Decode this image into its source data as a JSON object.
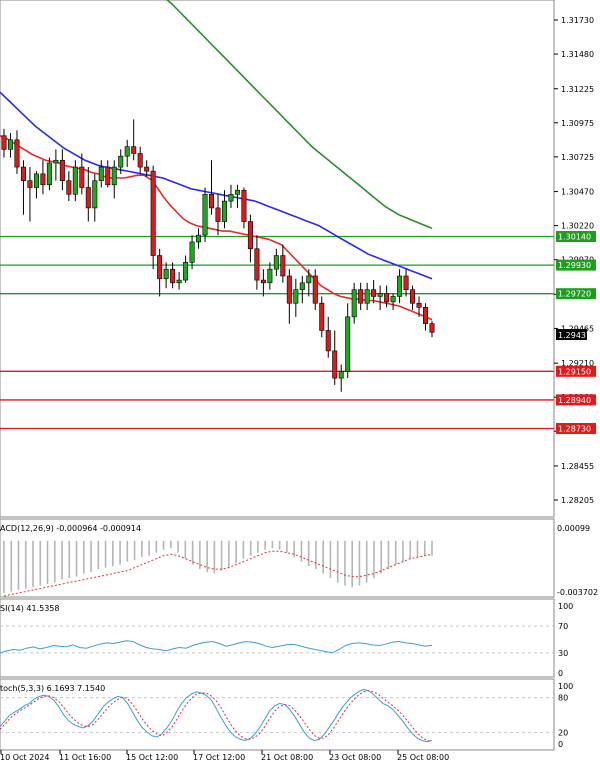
{
  "chart_data": {
    "type": "candlestick",
    "price_axis": {
      "ticks": [
        1.3173,
        1.3148,
        1.31225,
        1.30975,
        1.30725,
        1.3047,
        1.3022,
        1.2997,
        1.29715,
        1.29465,
        1.2921,
        1.2896,
        1.2871,
        1.28455,
        1.28205
      ],
      "tick_labels": [
        "1.31730",
        "1.31480",
        "1.31225",
        "1.30975",
        "1.30725",
        "1.30470",
        "1.30220",
        "1.29970",
        "1.29715",
        "1.29465",
        "1.29210",
        "1.28960",
        "1.28710",
        "1.28455",
        "1.28205"
      ],
      "range": [
        1.2802,
        1.3189
      ]
    },
    "x_labels": [
      "10 Oct 2024",
      "11 Oct 16:00",
      "15 Oct 12:00",
      "17 Oct 12:00",
      "21 Oct 08:00",
      "23 Oct 08:00",
      "25 Oct 08:00"
    ],
    "current_price": "1.29437",
    "resistance_levels": [
      {
        "value": 1.3014,
        "label": "1.30140",
        "color": "#1e9e1e"
      },
      {
        "value": 1.2993,
        "label": "1.29930",
        "color": "#1e9e1e"
      },
      {
        "value": 1.2972,
        "label": "1.29720",
        "color": "#1e9e1e"
      }
    ],
    "support_levels": [
      {
        "value": 1.2915,
        "label": "1.29150",
        "color": "#e31a1a"
      },
      {
        "value": 1.2894,
        "label": "1.28940",
        "color": "#e31a1a"
      },
      {
        "value": 1.2873,
        "label": "1.28730",
        "color": "#e31a1a"
      }
    ],
    "candles": [
      [
        1.3088,
        1.3093,
        1.3072,
        1.3078
      ],
      [
        1.3078,
        1.309,
        1.3072,
        1.3085
      ],
      [
        1.3085,
        1.3092,
        1.306,
        1.3065
      ],
      [
        1.3065,
        1.307,
        1.303,
        1.3055
      ],
      [
        1.3055,
        1.3065,
        1.3025,
        1.305
      ],
      [
        1.305,
        1.3062,
        1.3042,
        1.306
      ],
      [
        1.306,
        1.307,
        1.3045,
        1.3052
      ],
      [
        1.3052,
        1.3072,
        1.3048,
        1.3068
      ],
      [
        1.3068,
        1.3078,
        1.3055,
        1.307
      ],
      [
        1.307,
        1.3078,
        1.3048,
        1.3055
      ],
      [
        1.3055,
        1.3062,
        1.304,
        1.3045
      ],
      [
        1.3045,
        1.307,
        1.304,
        1.3065
      ],
      [
        1.3065,
        1.3075,
        1.3045,
        1.305
      ],
      [
        1.305,
        1.3065,
        1.3025,
        1.3035
      ],
      [
        1.3035,
        1.306,
        1.3025,
        1.3055
      ],
      [
        1.3055,
        1.307,
        1.305,
        1.3065
      ],
      [
        1.3065,
        1.307,
        1.305,
        1.3052
      ],
      [
        1.3052,
        1.307,
        1.3042,
        1.3065
      ],
      [
        1.3065,
        1.3078,
        1.306,
        1.3073
      ],
      [
        1.3073,
        1.3085,
        1.3065,
        1.308
      ],
      [
        1.308,
        1.31,
        1.307,
        1.3075
      ],
      [
        1.3075,
        1.308,
        1.306,
        1.3065
      ],
      [
        1.3065,
        1.307,
        1.3058,
        1.3062
      ],
      [
        1.3062,
        1.3066,
        1.299,
        1.3
      ],
      [
        1.3,
        1.3005,
        1.297,
        1.2983
      ],
      [
        1.2983,
        1.2995,
        1.2976,
        1.299
      ],
      [
        1.299,
        1.2995,
        1.2976,
        1.298
      ],
      [
        1.298,
        1.2988,
        1.2975,
        1.2982
      ],
      [
        1.2982,
        1.3,
        1.298,
        1.2995
      ],
      [
        1.2995,
        1.3015,
        1.299,
        1.301
      ],
      [
        1.301,
        1.302,
        1.3005,
        1.3015
      ],
      [
        1.3015,
        1.305,
        1.301,
        1.3045
      ],
      [
        1.3045,
        1.307,
        1.303,
        1.3035
      ],
      [
        1.3035,
        1.3045,
        1.3015,
        1.3025
      ],
      [
        1.3025,
        1.3048,
        1.302,
        1.304
      ],
      [
        1.304,
        1.3052,
        1.3035,
        1.3045
      ],
      [
        1.3045,
        1.3052,
        1.3035,
        1.3048
      ],
      [
        1.3048,
        1.305,
        1.302,
        1.3025
      ],
      [
        1.3025,
        1.303,
        1.2995,
        1.3005
      ],
      [
        1.3005,
        1.3015,
        1.2975,
        1.2982
      ],
      [
        1.2982,
        1.299,
        1.297,
        1.298
      ],
      [
        1.298,
        1.2995,
        1.2975,
        1.299
      ],
      [
        1.299,
        1.3005,
        1.2985,
        1.3
      ],
      [
        1.3,
        1.3008,
        1.298,
        1.2985
      ],
      [
        1.2985,
        1.299,
        1.295,
        1.2965
      ],
      [
        1.2965,
        1.2983,
        1.2955,
        1.2975
      ],
      [
        1.2975,
        1.2985,
        1.2965,
        1.298
      ],
      [
        1.298,
        1.299,
        1.297,
        1.2985
      ],
      [
        1.2985,
        1.299,
        1.296,
        1.2965
      ],
      [
        1.2965,
        1.297,
        1.294,
        1.2945
      ],
      [
        1.2945,
        1.2955,
        1.2925,
        1.293
      ],
      [
        1.293,
        1.2945,
        1.2905,
        1.291
      ],
      [
        1.291,
        1.292,
        1.29,
        1.2915
      ],
      [
        1.2915,
        1.2965,
        1.291,
        1.2955
      ],
      [
        1.2955,
        1.298,
        1.295,
        1.2975
      ],
      [
        1.2975,
        1.298,
        1.296,
        1.2965
      ],
      [
        1.2965,
        1.298,
        1.296,
        1.2975
      ],
      [
        1.2975,
        1.2982,
        1.2965,
        1.297
      ],
      [
        1.297,
        1.2978,
        1.296,
        1.2972
      ],
      [
        1.2972,
        1.2978,
        1.2962,
        1.2966
      ],
      [
        1.2966,
        1.2972,
        1.296,
        1.297
      ],
      [
        1.297,
        1.299,
        1.2965,
        1.2985
      ],
      [
        1.2985,
        1.299,
        1.297,
        1.2975
      ],
      [
        1.2975,
        1.2978,
        1.296,
        1.2965
      ],
      [
        1.2965,
        1.297,
        1.2955,
        1.2962
      ],
      [
        1.2962,
        1.2965,
        1.2945,
        1.295
      ],
      [
        1.295,
        1.2952,
        1.294,
        1.29437
      ]
    ],
    "series": [
      {
        "name": "",
        "color": "#e52a2a",
        "values": [
          1.3088,
          1.3086,
          1.3083,
          1.308,
          1.3077,
          1.3074,
          1.3072,
          1.307,
          1.3069,
          1.3068,
          1.3066,
          1.3065,
          1.3064,
          1.3063,
          1.3061,
          1.306,
          1.3058,
          1.3057,
          1.3057,
          1.3057,
          1.3058,
          1.3059,
          1.3059,
          1.3056,
          1.305,
          1.3043,
          1.3037,
          1.3032,
          1.3027,
          1.3024,
          1.3022,
          1.3021,
          1.302,
          1.3019,
          1.3018,
          1.3018,
          1.3017,
          1.3016,
          1.3015,
          1.3014,
          1.3013,
          1.3012,
          1.301,
          1.3008,
          1.3003,
          1.2998,
          1.2993,
          1.2988,
          1.2983,
          1.2978,
          1.2975,
          1.2972,
          1.297,
          1.2969,
          1.2968,
          1.2968,
          1.2967,
          1.2967,
          1.2966,
          1.2965,
          1.2964,
          1.2963,
          1.2961,
          1.2959,
          1.2957,
          1.2955,
          1.2953
        ]
      },
      {
        "name": "",
        "color": "#2a2aed",
        "values": [
          1.312,
          1.3115,
          1.311,
          1.3105,
          1.31,
          1.3095,
          1.3091,
          1.3087,
          1.3083,
          1.3079,
          1.3076,
          1.3073,
          1.307,
          1.3068,
          1.3066,
          1.3065,
          1.3064,
          1.3063,
          1.3062,
          1.3061,
          1.306,
          1.3059,
          1.3058,
          1.3057,
          1.3055,
          1.3053,
          1.3051,
          1.3049,
          1.3048,
          1.3047,
          1.3046,
          1.3045,
          1.3044,
          1.3043,
          1.3042,
          1.3041,
          1.304,
          1.3038,
          1.3036,
          1.3034,
          1.3032,
          1.303,
          1.3028,
          1.3026,
          1.3024,
          1.3022,
          1.3019,
          1.3016,
          1.3013,
          1.301,
          1.3007,
          1.3004,
          1.3001,
          1.2999,
          1.2997,
          1.2995,
          1.2993,
          1.2991,
          1.2989,
          1.2987,
          1.2985,
          1.2983
        ]
      },
      {
        "name": "",
        "color": "#2a8f2a",
        "values": [
          1.3189,
          1.3185,
          1.318,
          1.3175,
          1.317,
          1.3165,
          1.316,
          1.3155,
          1.315,
          1.3145,
          1.314,
          1.3135,
          1.313,
          1.3125,
          1.312,
          1.3115,
          1.311,
          1.3105,
          1.31,
          1.3095,
          1.309,
          1.3085,
          1.308,
          1.3076,
          1.3072,
          1.3068,
          1.3064,
          1.306,
          1.3056,
          1.3052,
          1.3048,
          1.3044,
          1.304,
          1.3036,
          1.3033,
          1.303,
          1.3028,
          1.3026,
          1.3024,
          1.3022,
          1.302
        ]
      }
    ],
    "macd": {
      "label": "ACD(12,26,9) -0.000964 -0.000914",
      "axis_top": "0.00099",
      "axis_bottom": "-0.003702",
      "histogram": [
        -0.0035,
        -0.0034,
        -0.0033,
        -0.0032,
        -0.0031,
        -0.003,
        -0.0029,
        -0.0028,
        -0.0026,
        -0.0025,
        -0.0024,
        -0.0022,
        -0.0021,
        -0.0019,
        -0.0018,
        -0.0017,
        -0.0016,
        -0.0014,
        -0.0013,
        -0.0011,
        -0.001,
        -0.0008,
        -0.0006,
        -0.0005,
        -0.0008,
        -0.0012,
        -0.0016,
        -0.0019,
        -0.0021,
        -0.0022,
        -0.002,
        -0.0018,
        -0.0015,
        -0.0012,
        -0.001,
        -0.0008,
        -0.0006,
        -0.0005,
        -0.0006,
        -0.0008,
        -0.0011,
        -0.0014,
        -0.0017,
        -0.0019,
        -0.0022,
        -0.0025,
        -0.0028,
        -0.003,
        -0.0031,
        -0.003,
        -0.0028,
        -0.0025,
        -0.0022,
        -0.0019,
        -0.0016,
        -0.0014,
        -0.0012,
        -0.0011,
        -0.001,
        -0.001
      ],
      "signal": [
        -0.0037,
        -0.0036,
        -0.0035,
        -0.0034,
        -0.0033,
        -0.0032,
        -0.0031,
        -0.003,
        -0.0029,
        -0.0028,
        -0.0027,
        -0.0026,
        -0.0025,
        -0.0024,
        -0.0023,
        -0.0022,
        -0.0021,
        -0.002,
        -0.0018,
        -0.0016,
        -0.0014,
        -0.0012,
        -0.001,
        -0.0009,
        -0.001,
        -0.0012,
        -0.0014,
        -0.0016,
        -0.0018,
        -0.0019,
        -0.0019,
        -0.0018,
        -0.0016,
        -0.0014,
        -0.0012,
        -0.001,
        -0.0008,
        -0.0007,
        -0.0007,
        -0.0008,
        -0.0009,
        -0.0011,
        -0.0013,
        -0.0015,
        -0.0017,
        -0.0019,
        -0.0021,
        -0.0023,
        -0.0024,
        -0.0024,
        -0.0023,
        -0.0022,
        -0.002,
        -0.0018,
        -0.0016,
        -0.0014,
        -0.0012,
        -0.0011,
        -0.001,
        -0.0009
      ]
    },
    "rsi": {
      "label": "SI(14) 41.5358",
      "levels": [
        100,
        70,
        30,
        0
      ],
      "values": [
        30,
        33,
        35,
        34,
        37,
        39,
        36,
        38,
        41,
        40,
        39,
        42,
        38,
        37,
        40,
        43,
        45,
        44,
        46,
        48,
        47,
        42,
        38,
        36,
        35,
        33,
        36,
        38,
        37,
        41,
        44,
        46,
        47,
        44,
        40,
        42,
        45,
        47,
        46,
        44,
        40,
        38,
        40,
        42,
        43,
        41,
        38,
        36,
        34,
        32,
        30,
        35,
        41,
        44,
        45,
        44,
        42,
        41,
        43,
        46,
        47,
        45,
        44,
        42,
        40,
        41.5
      ]
    },
    "stoch": {
      "label": "toch(5,3,3) 6.1693 7.1540",
      "levels": [
        100,
        80,
        20,
        0
      ],
      "k": [
        30,
        40,
        50,
        55,
        60,
        66,
        70,
        78,
        82,
        84,
        82,
        75,
        64,
        50,
        40,
        34,
        30,
        28,
        32,
        40,
        52,
        64,
        72,
        78,
        82,
        80,
        70,
        55,
        40,
        28,
        20,
        14,
        12,
        18,
        28,
        40,
        56,
        70,
        80,
        86,
        90,
        88,
        84,
        76,
        62,
        46,
        32,
        20,
        12,
        8,
        6,
        10,
        18,
        30,
        44,
        58,
        66,
        70,
        68,
        60,
        48,
        34,
        20,
        10,
        6,
        8,
        16,
        28,
        40,
        54,
        66,
        76,
        84,
        90,
        94,
        92,
        86,
        78,
        70,
        66,
        60,
        50,
        40,
        28,
        18,
        10,
        6,
        4,
        6
      ],
      "d": [
        25,
        34,
        44,
        51,
        57,
        62,
        67,
        73,
        79,
        82,
        83,
        80,
        73,
        63,
        52,
        43,
        36,
        31,
        30,
        34,
        43,
        53,
        63,
        71,
        77,
        81,
        78,
        69,
        56,
        43,
        32,
        23,
        17,
        14,
        20,
        29,
        42,
        56,
        69,
        79,
        86,
        88,
        88,
        83,
        75,
        63,
        48,
        34,
        22,
        14,
        9,
        8,
        12,
        19,
        31,
        45,
        57,
        65,
        68,
        66,
        59,
        49,
        37,
        25,
        15,
        10,
        10,
        17,
        28,
        41,
        54,
        66,
        76,
        84,
        90,
        92,
        90,
        86,
        79,
        72,
        66,
        59,
        50,
        40,
        29,
        19,
        11,
        6,
        5
      ]
    }
  }
}
